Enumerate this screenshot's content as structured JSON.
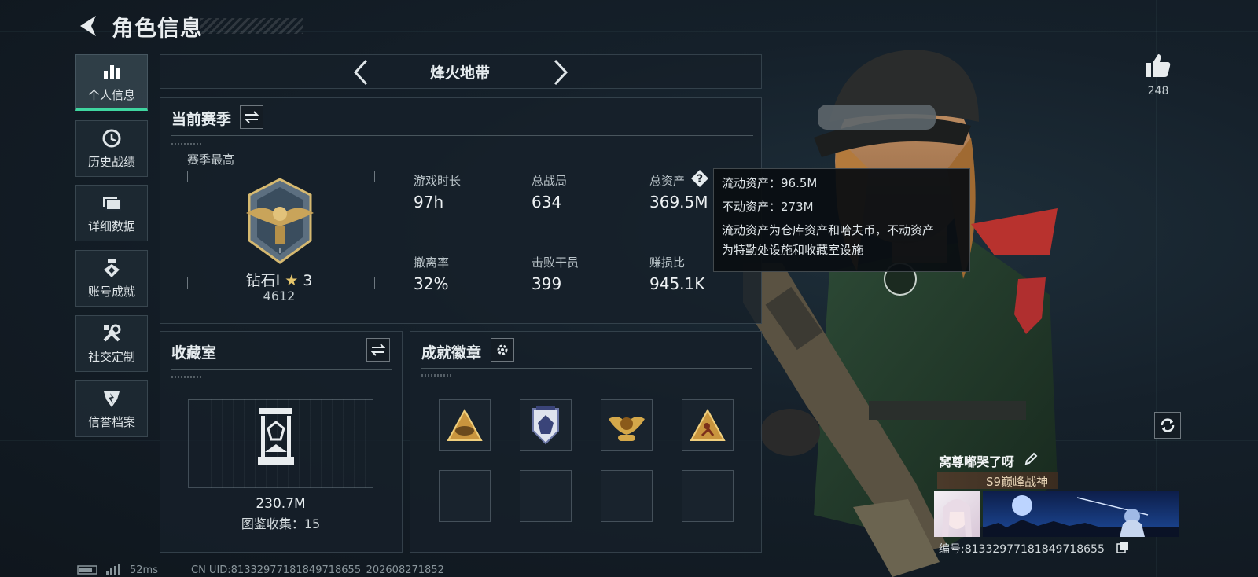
{
  "header": {
    "title": "角色信息"
  },
  "sidebar": {
    "items": [
      {
        "label": "个人信息",
        "icon": "bar-chart-icon",
        "active": true
      },
      {
        "label": "历史战绩",
        "icon": "history-clock-icon"
      },
      {
        "label": "详细数据",
        "icon": "folder-icon"
      },
      {
        "label": "账号成就",
        "icon": "medal-icon"
      },
      {
        "label": "社交定制",
        "icon": "tools-icon"
      },
      {
        "label": "信誉档案",
        "icon": "shield-icon"
      }
    ]
  },
  "mode_selector": {
    "label": "烽火地带"
  },
  "season": {
    "title": "当前赛季",
    "best_label": "赛季最高",
    "rank_name": "钻石Ⅰ",
    "rank_stars": "3",
    "rank_points": "4612",
    "stats": [
      {
        "label": "游戏时长",
        "value": "97h"
      },
      {
        "label": "总战局",
        "value": "634"
      },
      {
        "label": "总资产",
        "value": "369.5M"
      },
      {
        "label": "撤离率",
        "value": "32%"
      },
      {
        "label": "击败干员",
        "value": "399"
      },
      {
        "label": "赚损比",
        "value": "945.1K"
      }
    ]
  },
  "tooltip": {
    "liquid": "流动资产：96.5M",
    "fixed": "不动资产：273M",
    "note_line1": "流动资产为仓库资产和哈夫币，不动资产",
    "note_line2": "为特勤处设施和收藏室设施"
  },
  "collection": {
    "title": "收藏室",
    "value": "230.7M",
    "catalog": "图鉴收集：15"
  },
  "achievements": {
    "title": "成就徽章"
  },
  "likes": {
    "count": "248"
  },
  "player": {
    "name": "窝尊嘟哭了呀",
    "title_badge": "S9巅峰战神",
    "id_line": "编号:81332977181849718655"
  },
  "status_bar": {
    "ping": "52ms",
    "uid": "CN UID:81332977181849718655_202608271852"
  },
  "colors": {
    "accent": "#3fd6a0",
    "gold": "#d4a84a"
  }
}
